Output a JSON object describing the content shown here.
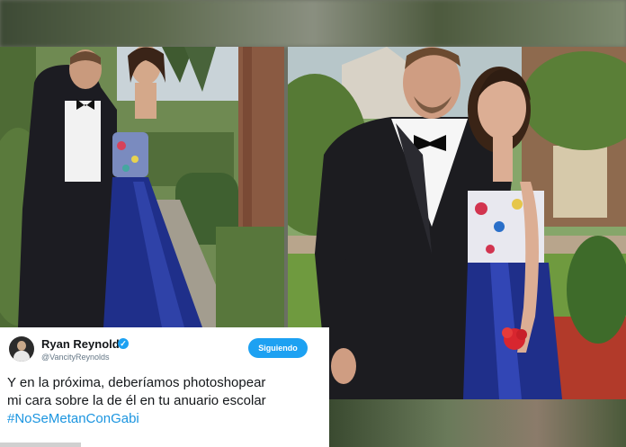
{
  "tweet": {
    "user_name": "Ryan Reynolds",
    "handle": "@VancityReynolds",
    "follow_label": "Siguiendo",
    "text_line_1": "Y en la próxima, deberíamos photoshopear",
    "text_line_2": "mi cara sobre la de él en tu anuario escolar",
    "hashtag": "#NoSeMetanConGabi"
  },
  "colors": {
    "twitter_blue": "#1da1f2",
    "hashtag_blue": "#1b95e0",
    "gown_blue": "#1f2f8a",
    "suit_black": "#1c1c20"
  },
  "icons": [
    "verified-badge-icon",
    "avatar"
  ]
}
